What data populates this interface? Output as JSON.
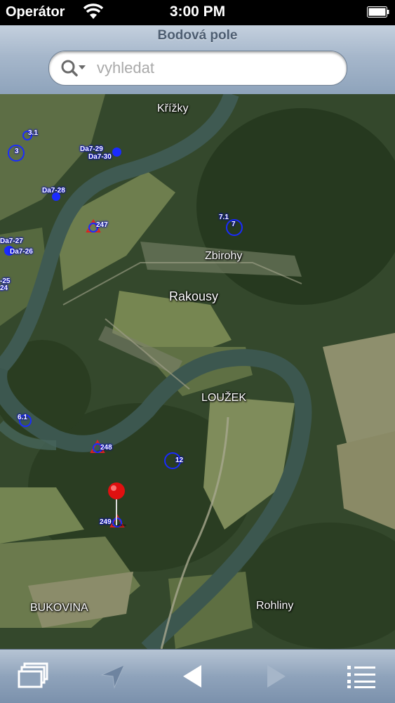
{
  "status_bar": {
    "carrier": "Operátor",
    "time": "3:00 PM"
  },
  "nav": {
    "title": "Bodová pole"
  },
  "search": {
    "placeholder": "vyhledat",
    "value": ""
  },
  "map": {
    "places": {
      "krizky": "Křížky",
      "zbirohy": "Zbirohy",
      "rakousy": "Rakousy",
      "louzek": "LOUŽEK",
      "bukovina": "BUKOVINA",
      "rohliny": "Rohliny"
    },
    "points": {
      "p3_1": "3.1",
      "p3": "3",
      "da7_29": "Da7-29",
      "da7_30": "Da7-30",
      "da7_28": "Da7-28",
      "p247": "247",
      "p7_1": "7.1",
      "p7": "7",
      "da7_27": "Da7-27",
      "da7_26": "Da7-26",
      "p25": "-25",
      "p24": "24",
      "p6_1": "6.1",
      "p248": "248",
      "p12": "12",
      "p249": "249"
    }
  },
  "toolbar": {
    "layers": "layers-icon",
    "locate": "location-arrow-icon",
    "back": "back-arrow-icon",
    "forward": "forward-arrow-icon",
    "list": "list-icon"
  }
}
